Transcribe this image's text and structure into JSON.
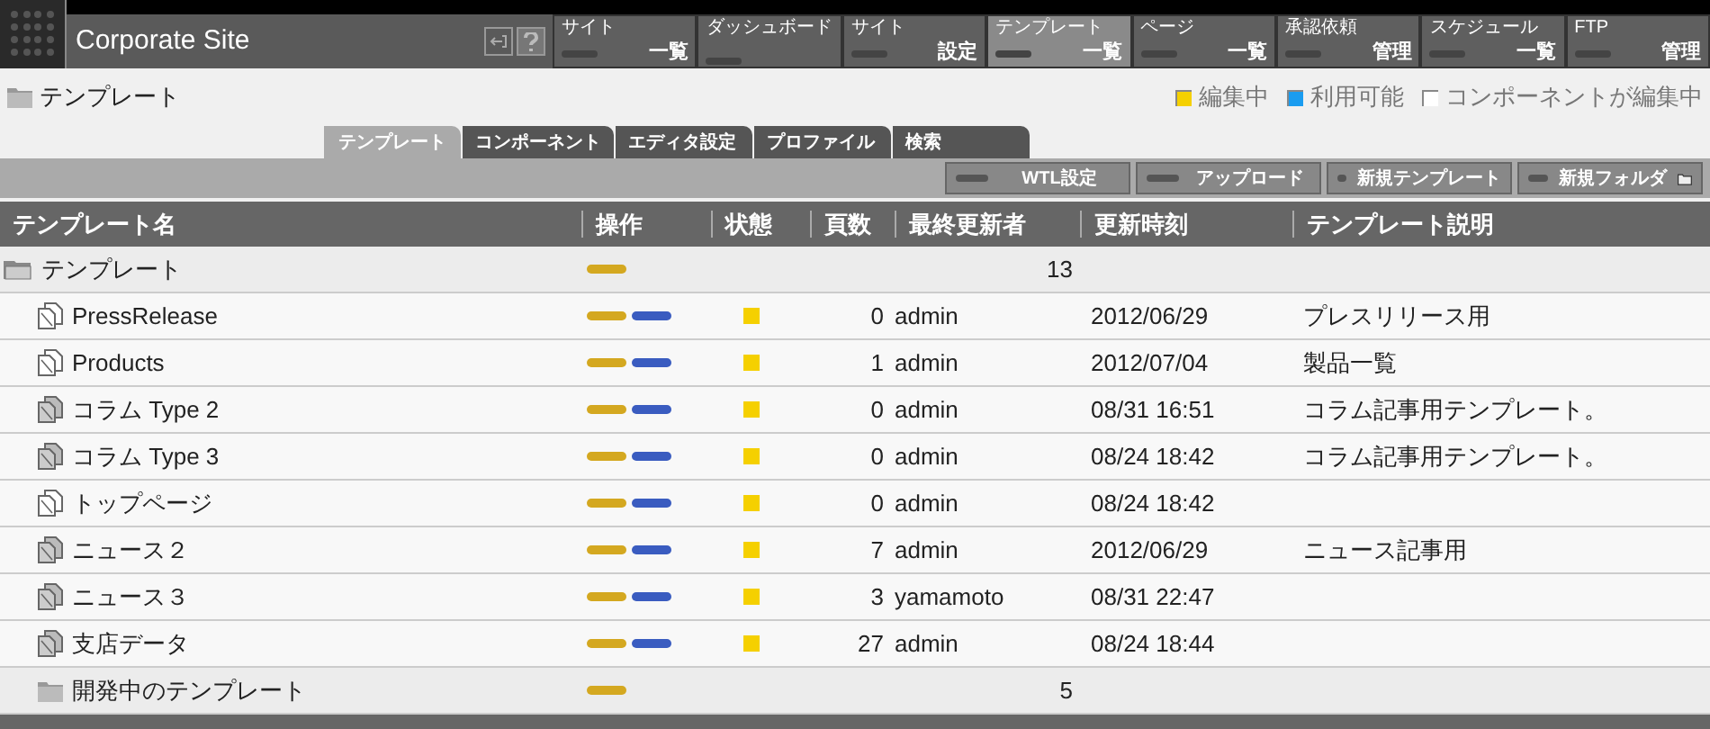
{
  "header": {
    "title": "Corporate Site",
    "nav": [
      {
        "top": "サイト",
        "bottom": "一覧",
        "selected": false
      },
      {
        "top": "ダッシュボード",
        "selected": false
      },
      {
        "top": "サイト",
        "bottom": "設定",
        "selected": false
      },
      {
        "top": "テンプレート",
        "bottom": "一覧",
        "selected": true
      },
      {
        "top": "ページ",
        "bottom": "一覧",
        "selected": false
      },
      {
        "top": "承認依頼",
        "bottom": "管理",
        "selected": false
      },
      {
        "top": "スケジュール",
        "bottom": "一覧",
        "selected": false
      },
      {
        "top": "FTP",
        "bottom": "管理",
        "selected": false
      }
    ]
  },
  "breadcrumb": "テンプレート",
  "legend": [
    {
      "label": "編集中",
      "color": "#f5d000"
    },
    {
      "label": "利用可能",
      "color": "#1a9cf0"
    },
    {
      "label": "コンポーネントが編集中",
      "color": "#ffffff"
    }
  ],
  "tabs": [
    {
      "label": "テンプレート",
      "selected": true
    },
    {
      "label": "コンポーネント",
      "selected": false
    },
    {
      "label": "エディタ設定",
      "selected": false
    },
    {
      "label": "プロファイル",
      "selected": false
    },
    {
      "label": "検索",
      "selected": false
    }
  ],
  "toolbar": [
    {
      "label": "WTL設定",
      "kind": "plain"
    },
    {
      "label": "アップロード",
      "kind": "plain"
    },
    {
      "label": "新規テンプレート",
      "kind": "plain"
    },
    {
      "label": "新規フォルダ",
      "kind": "folder"
    }
  ],
  "table": {
    "columns": [
      "テンプレート名",
      "操作",
      "状態",
      "頁数",
      "最終更新者",
      "更新時刻",
      "テンプレート説明"
    ],
    "rows": [
      {
        "kind": "folder",
        "expanded": true,
        "name": "テンプレート",
        "count": "13"
      },
      {
        "kind": "file",
        "shaded": false,
        "name": "PressRelease",
        "color": "#f5d000",
        "pages": "0",
        "author": "admin",
        "updated": "2012/06/29",
        "description": "プレスリリース用"
      },
      {
        "kind": "file",
        "shaded": false,
        "name": "Products",
        "color": "#f5d000",
        "pages": "1",
        "author": "admin",
        "updated": "2012/07/04",
        "description": "製品一覧"
      },
      {
        "kind": "file",
        "shaded": true,
        "name": "コラム Type 2",
        "color": "#f5d000",
        "pages": "0",
        "author": "admin",
        "updated": "08/31 16:51",
        "description": "コラム記事用テンプレート。"
      },
      {
        "kind": "file",
        "shaded": true,
        "name": "コラム Type 3",
        "color": "#f5d000",
        "pages": "0",
        "author": "admin",
        "updated": "08/24 18:42",
        "description": "コラム記事用テンプレート。"
      },
      {
        "kind": "file",
        "shaded": false,
        "name": "トップページ",
        "color": "#f5d000",
        "pages": "0",
        "author": "admin",
        "updated": "08/24 18:42"
      },
      {
        "kind": "file",
        "shaded": true,
        "name": "ニュース２",
        "color": "#f5d000",
        "pages": "7",
        "author": "admin",
        "updated": "2012/06/29",
        "description": "ニュース記事用"
      },
      {
        "kind": "file",
        "shaded": true,
        "name": "ニュース３",
        "color": "#f5d000",
        "pages": "3",
        "author": "yamamoto",
        "updated": "08/31 22:47"
      },
      {
        "kind": "file",
        "shaded": true,
        "name": "支店データ",
        "color": "#f5d000",
        "pages": "27",
        "author": "admin",
        "updated": "08/24 18:44"
      },
      {
        "kind": "folder",
        "expanded": false,
        "name": "開発中のテンプレート",
        "count": "5"
      }
    ]
  }
}
